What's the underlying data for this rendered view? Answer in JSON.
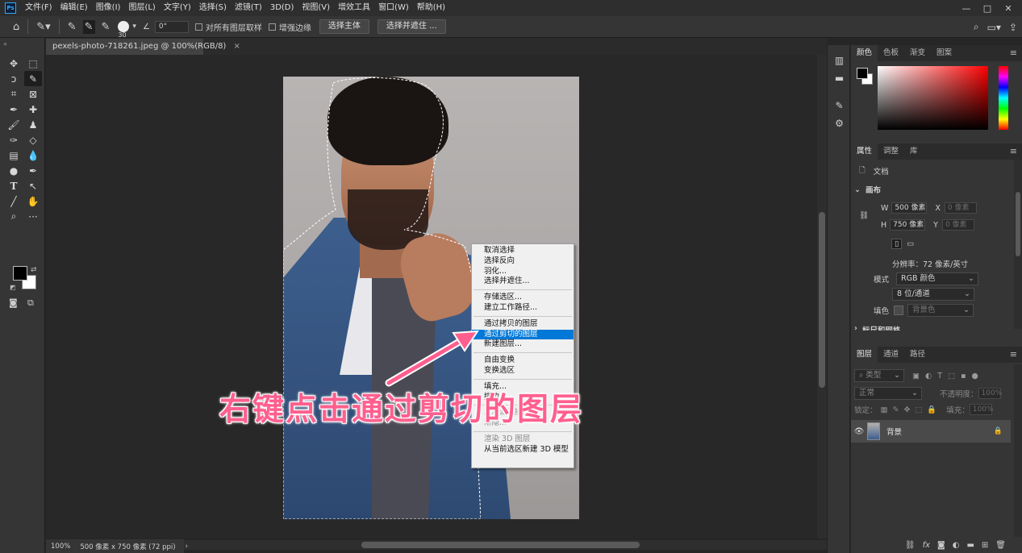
{
  "menubar": {
    "logo": "Ps",
    "items": [
      "文件(F)",
      "编辑(E)",
      "图像(I)",
      "图层(L)",
      "文字(Y)",
      "选择(S)",
      "滤镜(T)",
      "3D(D)",
      "视图(V)",
      "增效工具",
      "窗口(W)",
      "帮助(H)"
    ],
    "window_controls": [
      "—",
      "□",
      "✕"
    ]
  },
  "optionsbar": {
    "brush_size": "30",
    "angle": "0°",
    "sample_all_layers": "对所有图层取样",
    "enhance_edge": "增强边缘",
    "select_subject": "选择主体",
    "select_and_mask": "选择并遮住 ..."
  },
  "document": {
    "tab_title": "pexels-photo-718261.jpeg @ 100%(RGB/8)",
    "close": "×"
  },
  "context_menu": {
    "groups": [
      [
        {
          "label": "取消选择"
        },
        {
          "label": "选择反向"
        },
        {
          "label": "羽化..."
        },
        {
          "label": "选择并遮住..."
        }
      ],
      [
        {
          "label": "存储选区..."
        },
        {
          "label": "建立工作路径..."
        }
      ],
      [
        {
          "label": "通过拷贝的图层"
        },
        {
          "label": "通过剪切的图层",
          "highlighted": true
        },
        {
          "label": "新建图层..."
        }
      ],
      [
        {
          "label": "自由变换"
        },
        {
          "label": "变换选区"
        }
      ],
      [
        {
          "label": "填充..."
        },
        {
          "label": "描边..."
        }
      ],
      [
        {
          "label": "上次滤镜操作",
          "disabled": true
        },
        {
          "label": "渐隐...",
          "disabled": true
        }
      ],
      [
        {
          "label": "渲染 3D 图层",
          "disabled": true
        },
        {
          "label": "从当前选区新建 3D 模型"
        }
      ]
    ]
  },
  "annotation": "右键点击通过剪切的图层",
  "statusbar": {
    "zoom": "100%",
    "doc_size": "500 像素 x 750 像素 (72 ppi)",
    "arrow": "›"
  },
  "color_panel": {
    "tabs": [
      "颜色",
      "色板",
      "渐变",
      "图案"
    ],
    "fg": "#000000",
    "bg": "#ffffff"
  },
  "properties_panel": {
    "tabs": [
      "属性",
      "调整",
      "库"
    ],
    "doc_label": "文档",
    "section": "画布",
    "w_label": "W",
    "w_value": "500 像素",
    "h_label": "H",
    "h_value": "750 像素",
    "x_label": "X",
    "x_value": "0 像素",
    "y_label": "Y",
    "y_value": "0 像素",
    "resolution": "分辨率：72 像素/英寸",
    "mode_label": "模式",
    "mode_value": "RGB 颜色",
    "depth_value": "8 位/通道",
    "fill_label": "填色",
    "fill_value": "背景色",
    "next_section": "标尺和网格"
  },
  "layers_panel": {
    "tabs": [
      "图层",
      "通道",
      "路径"
    ],
    "filter_placeholder": "类型",
    "blend_mode": "正常",
    "opacity_label": "不透明度：",
    "opacity_value": "100%",
    "lock_label": "锁定：",
    "fill_label": "填充：",
    "fill_value": "100%",
    "layers": [
      {
        "name": "背景",
        "locked": true,
        "visible": true
      }
    ]
  }
}
